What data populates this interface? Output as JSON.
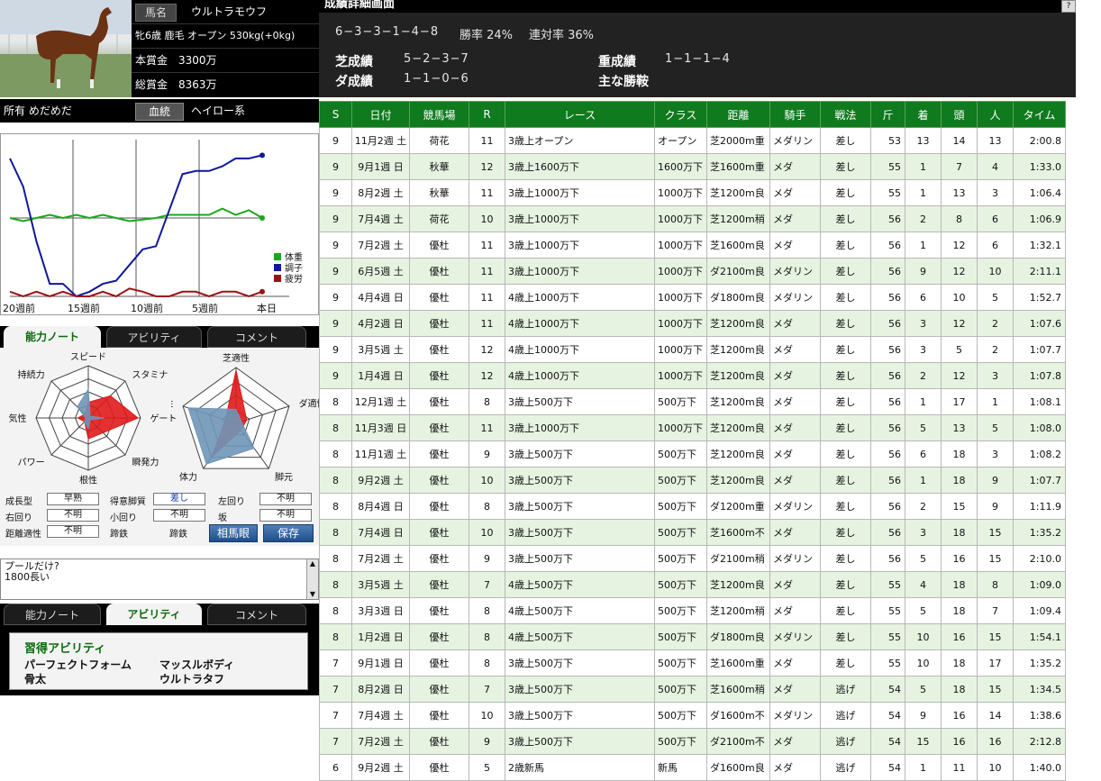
{
  "horse": {
    "name_label": "馬名",
    "name": "ウルトラモウフ",
    "profile": "牝6歳 鹿毛 オープン 530kg(+0kg)",
    "prize_label": "本賞金",
    "prize": "3300万",
    "total_prize_label": "総賞金",
    "total_prize": "8363万",
    "owner": "所有 めだめだ",
    "bloodline_button": "血統",
    "bloodline": "ヘイロー系"
  },
  "graph": {
    "x_labels": [
      "20週前",
      "15週前",
      "10週前",
      "5週前",
      "本日"
    ],
    "legend": [
      {
        "label": "体重",
        "color": "#1aa81a"
      },
      {
        "label": "調子",
        "color": "#10189a"
      },
      {
        "label": "疲労",
        "color": "#a01010"
      }
    ],
    "weight": [
      50,
      48,
      50,
      52,
      50,
      52,
      50,
      52,
      50,
      48,
      49,
      50,
      52,
      52,
      52,
      52,
      56,
      52,
      55,
      50
    ],
    "condition": [
      88,
      70,
      35,
      8,
      8,
      0,
      3,
      8,
      10,
      20,
      30,
      32,
      55,
      78,
      80,
      80,
      83,
      88,
      88,
      90
    ],
    "fatigue": [
      3,
      0,
      3,
      0,
      3,
      0,
      0,
      3,
      0,
      5,
      3,
      0,
      0,
      3,
      3,
      0,
      3,
      3,
      0,
      3
    ]
  },
  "tabs1": [
    "能力ノート",
    "アビリティ",
    "コメント"
  ],
  "radar1": {
    "labels": [
      "スピード",
      "スタミナ",
      "ゲート",
      "瞬発力",
      "根性",
      "パワー",
      "気性",
      "持続力"
    ],
    "blue": [
      0.55,
      0.05,
      0.3,
      0.05,
      0.2,
      0.1,
      0.05,
      0.3
    ],
    "red": [
      0.3,
      0.6,
      0.95,
      0.4,
      0.4,
      0.1,
      0.2,
      0.1
    ]
  },
  "radar2": {
    "labels": [
      "芝適性",
      "ダ適性",
      "脚元",
      "体力",
      "重適性"
    ],
    "blue": [
      0.25,
      0.1,
      0.55,
      0.9,
      0.9
    ],
    "red": [
      0.95,
      0.2,
      0.15,
      0.75,
      0.2
    ]
  },
  "props": {
    "growth_label": "成長型",
    "growth": "早熟",
    "style_label": "得意脚質",
    "style": "差し",
    "left_label": "左回り",
    "left": "不明",
    "right_label": "右回り",
    "right": "不明",
    "small_label": "小回り",
    "small": "不明",
    "slope_label": "坂",
    "slope": "不明",
    "dist_label": "距離適性",
    "dist": "不明",
    "hoof1": "蹄鉄",
    "hoof2": "蹄鉄",
    "soubagan_button": "相馬眼",
    "save_button": "保存"
  },
  "memo": [
    "プールだけ?",
    "1800長い"
  ],
  "tabs2": [
    "能力ノート",
    "アビリティ",
    "コメント"
  ],
  "abilities": {
    "title": "習得アビリティ",
    "items": [
      "パーフェクトフォーム",
      "マッスルボディ",
      "骨太",
      "ウルトラタフ"
    ]
  },
  "detail": {
    "title": "成績詳細画面",
    "help": "?",
    "record": "6−3−3−1−4−8",
    "win_rate": "勝率 24%",
    "place_rate": "連対率 36%",
    "turf_label": "芝成績",
    "turf": "5−2−3−7",
    "heavy_label": "重成績",
    "heavy": "1−1−1−4",
    "dirt_label": "ダ成績",
    "dirt": "1−1−0−6",
    "main_wins_label": "主な勝鞍"
  },
  "results": {
    "headers": [
      "S",
      "日付",
      "競馬場",
      "R",
      "レース",
      "クラス",
      "距離",
      "騎手",
      "戦法",
      "斤",
      "着",
      "頭",
      "人",
      "タイム"
    ],
    "rows": [
      [
        "9",
        "11月2週 土",
        "荷花",
        "11",
        "3歳上オープン",
        "オープン",
        "芝2000m重",
        "メダリン",
        "差し",
        "53",
        "13",
        "14",
        "13",
        "2:00.8"
      ],
      [
        "9",
        "9月1週 日",
        "秋華",
        "12",
        "3歳上1600万下",
        "1600万下",
        "芝1600m重",
        "メダ",
        "差し",
        "55",
        "1",
        "7",
        "4",
        "1:33.0"
      ],
      [
        "9",
        "8月2週 土",
        "秋華",
        "11",
        "3歳上1000万下",
        "1000万下",
        "芝1200m良",
        "メダ",
        "差し",
        "55",
        "1",
        "13",
        "3",
        "1:06.4"
      ],
      [
        "9",
        "7月4週 土",
        "荷花",
        "10",
        "3歳上1000万下",
        "1000万下",
        "芝1200m稍",
        "メダ",
        "差し",
        "56",
        "2",
        "8",
        "6",
        "1:06.9"
      ],
      [
        "9",
        "7月2週 土",
        "優杜",
        "11",
        "3歳上1000万下",
        "1000万下",
        "芝1600m良",
        "メダ",
        "差し",
        "56",
        "1",
        "12",
        "6",
        "1:32.1"
      ],
      [
        "9",
        "6月5週 土",
        "優杜",
        "11",
        "3歳上1000万下",
        "1000万下",
        "ダ2100m良",
        "メダリン",
        "差し",
        "56",
        "9",
        "12",
        "10",
        "2:11.1"
      ],
      [
        "9",
        "4月4週 日",
        "優杜",
        "11",
        "4歳上1000万下",
        "1000万下",
        "ダ1800m良",
        "メダリン",
        "差し",
        "56",
        "6",
        "10",
        "5",
        "1:52.7"
      ],
      [
        "9",
        "4月2週 日",
        "優杜",
        "11",
        "4歳上1000万下",
        "1000万下",
        "芝1200m良",
        "メダ",
        "差し",
        "56",
        "3",
        "12",
        "2",
        "1:07.6"
      ],
      [
        "9",
        "3月5週 土",
        "優杜",
        "12",
        "4歳上1000万下",
        "1000万下",
        "芝1200m良",
        "メダ",
        "差し",
        "56",
        "3",
        "5",
        "2",
        "1:07.7"
      ],
      [
        "9",
        "1月4週 日",
        "優杜",
        "12",
        "4歳上1000万下",
        "1000万下",
        "芝1200m良",
        "メダ",
        "差し",
        "56",
        "2",
        "12",
        "3",
        "1:07.8"
      ],
      [
        "8",
        "12月1週 土",
        "優杜",
        "8",
        "3歳上500万下",
        "500万下",
        "芝1200m良",
        "メダ",
        "差し",
        "56",
        "1",
        "17",
        "1",
        "1:08.1"
      ],
      [
        "8",
        "11月3週 日",
        "優杜",
        "11",
        "3歳上1000万下",
        "1000万下",
        "芝1200m良",
        "メダ",
        "差し",
        "56",
        "5",
        "13",
        "5",
        "1:08.0"
      ],
      [
        "8",
        "11月1週 土",
        "優杜",
        "9",
        "3歳上500万下",
        "500万下",
        "芝1200m良",
        "メダ",
        "差し",
        "56",
        "6",
        "18",
        "3",
        "1:08.2"
      ],
      [
        "8",
        "9月2週 土",
        "優杜",
        "10",
        "3歳上500万下",
        "500万下",
        "芝1200m良",
        "メダ",
        "差し",
        "56",
        "1",
        "18",
        "9",
        "1:07.7"
      ],
      [
        "8",
        "8月4週 日",
        "優杜",
        "8",
        "3歳上500万下",
        "500万下",
        "ダ1200m重",
        "メダリン",
        "差し",
        "56",
        "2",
        "15",
        "9",
        "1:11.9"
      ],
      [
        "8",
        "7月4週 日",
        "優杜",
        "10",
        "3歳上500万下",
        "500万下",
        "芝1600m不",
        "メダ",
        "差し",
        "56",
        "3",
        "18",
        "15",
        "1:35.2"
      ],
      [
        "8",
        "7月2週 土",
        "優杜",
        "9",
        "3歳上500万下",
        "500万下",
        "ダ2100m稍",
        "メダリン",
        "差し",
        "56",
        "5",
        "16",
        "15",
        "2:10.0"
      ],
      [
        "8",
        "3月5週 土",
        "優杜",
        "7",
        "4歳上500万下",
        "500万下",
        "芝1200m良",
        "メダ",
        "差し",
        "55",
        "4",
        "18",
        "8",
        "1:09.0"
      ],
      [
        "8",
        "3月3週 日",
        "優杜",
        "8",
        "4歳上500万下",
        "500万下",
        "芝1200m稍",
        "メダ",
        "差し",
        "55",
        "5",
        "18",
        "7",
        "1:09.4"
      ],
      [
        "8",
        "1月2週 日",
        "優杜",
        "8",
        "4歳上500万下",
        "500万下",
        "ダ1800m良",
        "メダリン",
        "差し",
        "55",
        "10",
        "16",
        "15",
        "1:54.1"
      ],
      [
        "7",
        "9月1週 日",
        "優杜",
        "8",
        "3歳上500万下",
        "500万下",
        "芝1600m重",
        "メダ",
        "差し",
        "55",
        "10",
        "18",
        "17",
        "1:35.2"
      ],
      [
        "7",
        "8月2週 日",
        "優杜",
        "7",
        "3歳上500万下",
        "500万下",
        "芝1600m稍",
        "メダ",
        "逃げ",
        "54",
        "5",
        "18",
        "15",
        "1:34.5"
      ],
      [
        "7",
        "7月4週 土",
        "優杜",
        "10",
        "3歳上500万下",
        "500万下",
        "ダ1600m不",
        "メダリン",
        "逃げ",
        "54",
        "9",
        "16",
        "14",
        "1:38.6"
      ],
      [
        "7",
        "7月2週 土",
        "優杜",
        "9",
        "3歳上500万下",
        "500万下",
        "ダ2100m不",
        "メダ",
        "逃げ",
        "54",
        "15",
        "16",
        "16",
        "2:12.8"
      ],
      [
        "6",
        "9月2週 土",
        "優杜",
        "5",
        "2歳新馬",
        "新馬",
        "ダ1600m良",
        "メダ",
        "逃げ",
        "54",
        "1",
        "11",
        "10",
        "1:40.0"
      ]
    ]
  }
}
